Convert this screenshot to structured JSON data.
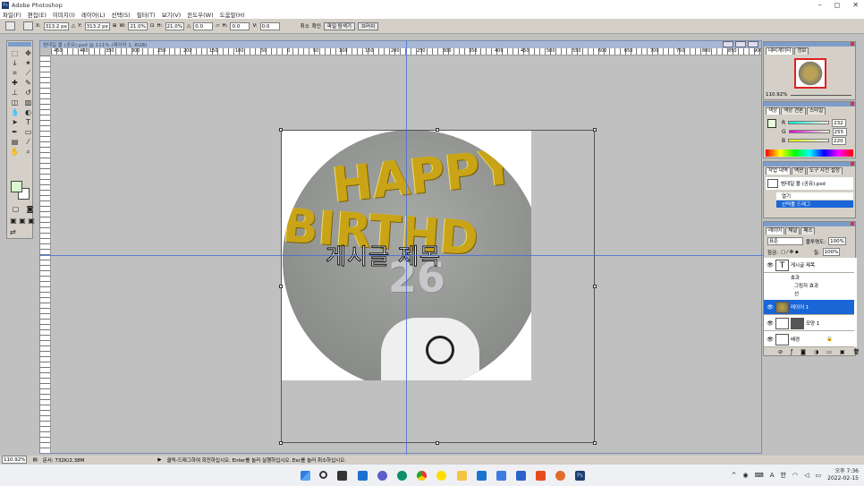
{
  "app": {
    "title": "Adobe Photoshop",
    "icon": "photoshop-icon"
  },
  "menu": [
    "파일(F)",
    "편집(E)",
    "이미지(I)",
    "레이어(L)",
    "선택(S)",
    "필터(T)",
    "보기(V)",
    "윈도우(W)",
    "도움말(H)"
  ],
  "options": {
    "x_label": "X:",
    "x": "313.2 px",
    "y_label": "Y:",
    "y": "313.2 px",
    "w_label": "W:",
    "w": "21.0%",
    "h_label": "H:",
    "h": "21.0%",
    "angle": "0.0",
    "hskew_label": "H:",
    "hskew": "0.0",
    "vskew_label": "V:",
    "vskew": "0.0",
    "cancel": "취소",
    "commit": "확인",
    "tab_file_browser": "파일 탐색기",
    "tab_brushes": "브러쉬"
  },
  "document": {
    "title": "범데일 볼 (공유).psd @ 111% (레이어 1, RGB)"
  },
  "ruler": [
    "450",
    "400",
    "350",
    "300",
    "250",
    "200",
    "150",
    "100",
    "50",
    "0",
    "50",
    "100",
    "150",
    "200",
    "250",
    "300",
    "350",
    "400",
    "450",
    "500",
    "550",
    "600",
    "650",
    "700",
    "750",
    "800",
    "850",
    "900"
  ],
  "image": {
    "overlay_text": "게시글 제목",
    "balloon_line1": "HAPPY",
    "balloon_line2": "BIRTHD",
    "balloon_number": "26"
  },
  "navigator": {
    "tabs": [
      "내비게이터",
      "정보"
    ],
    "zoom": "110.92%"
  },
  "color": {
    "tabs": [
      "색상",
      "색상 견본",
      "스타일"
    ],
    "r_label": "R",
    "r": "232",
    "g_label": "G",
    "g": "255",
    "b_label": "B",
    "b": "220",
    "fg_color": "#e8ffdc"
  },
  "history": {
    "tabs": [
      "작업 내역",
      "액션",
      "도구 사전 설정"
    ],
    "doc": "범데일 볼 (공유).psd",
    "items": [
      "열기",
      "선택툴 드래그"
    ]
  },
  "layers": {
    "tabs": [
      "레이어",
      "채널",
      "패스"
    ],
    "blend": "표준",
    "opacity_label": "불투명도:",
    "opacity": "100%",
    "lock_label": "잠금:",
    "fill_label": "칠:",
    "fill": "100%",
    "text_layer": "게시글 제목",
    "effects_label": "효과",
    "effect1": "그림자 효과",
    "effect2": "선",
    "layer1": "레이어 1",
    "shape_layer": "모양 1",
    "background": "배경"
  },
  "status": {
    "zoom": "110.92%",
    "doc_size": "문서: 732K/2.38M",
    "hint": "클릭-드래그하여 회전하십시오. Enter를 눌러 실행하십시오. Esc를 눌러 취소하십시오."
  },
  "taskbar": {
    "time": "오후 7:36",
    "date": "2022-02-15",
    "ime": "A",
    "lang": "한"
  }
}
